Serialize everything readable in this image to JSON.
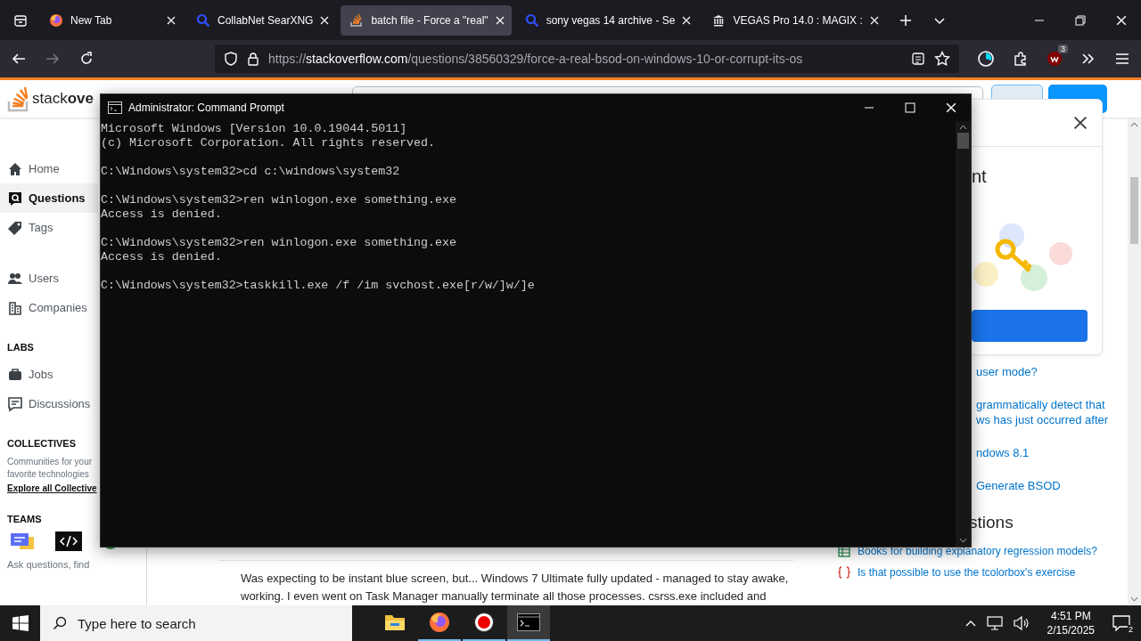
{
  "browser": {
    "tabs": [
      {
        "title": "New Tab",
        "kind": "browser",
        "selected": false
      },
      {
        "title": "CollabNet SearXNG",
        "kind": "search",
        "selected": false
      },
      {
        "title": "batch file - Force a \"real\"",
        "kind": "stack",
        "selected": true
      },
      {
        "title": "sony vegas 14 archive - Se",
        "kind": "search",
        "selected": false
      },
      {
        "title": "VEGAS Pro 14.0 : MAGIX :",
        "kind": "building",
        "selected": false
      }
    ],
    "url": "https://**stackoverflow.com**/questions/38560329/force-a-real-bsod-on-windows-10-or-corrupt-its-os",
    "extension_badge": "3"
  },
  "site": {
    "logo": "stack**ove**",
    "nav": [
      {
        "label": "Home",
        "kind": "home",
        "selected": false
      },
      {
        "label": "Questions",
        "kind": "questions",
        "selected": true
      },
      {
        "label": "Tags",
        "kind": "tags",
        "selected": false
      },
      {
        "label": "Users",
        "kind": "users",
        "selected": false
      },
      {
        "label": "Companies",
        "kind": "companies",
        "selected": false
      }
    ],
    "labs_heading": "LABS",
    "labs": [
      {
        "label": "Jobs",
        "kind": "jobs",
        "selected": false
      },
      {
        "label": "Discussions",
        "kind": "discussions",
        "selected": false
      }
    ],
    "collectives_heading": "COLLECTIVES",
    "collectives_lines": [
      "Communities for your",
      "favorite technologies"
    ],
    "collectives_link": "Explore all Collective",
    "teams_heading": "TEAMS",
    "teams_text": "Ask questions, find",
    "excerpt_lines": [
      "Was expecting to be instant blue screen, but... Windows 7 Ultimate fully updated - managed to stay awake,",
      "working. I even went on Task Manager manually terminate all those processes. csrss.exe included and"
    ],
    "card_heading": "nt",
    "related": [
      {
        "lines": [
          "user mode?"
        ]
      },
      {
        "lines": [
          "grammatically detect that",
          "ws has just occurred after"
        ]
      },
      {
        "lines": [
          "ndows 8.1"
        ]
      },
      {
        "lines": [
          "Generate BSOD"
        ]
      }
    ],
    "hot_heading": "stions",
    "hot": [
      {
        "title": "Books for building explanatory regression models?",
        "kind": "table"
      },
      {
        "title": "Is that possible to use the tcolorbox's exercise",
        "kind": "braces"
      }
    ]
  },
  "cmd": {
    "title": "Administrator: Command Prompt",
    "blocks": [
      [
        "Microsoft Windows [Version 10.0.19044.5011]",
        "(c) Microsoft Corporation. All rights reserved."
      ],
      [
        "C:\\Windows\\system32>cd c:\\windows\\system32"
      ],
      [
        "C:\\Windows\\system32>ren winlogon.exe something.exe",
        "Access is denied."
      ],
      [
        "C:\\Windows\\system32>ren winlogon.exe something.exe",
        "Access is denied."
      ],
      [
        "C:\\Windows\\system32>taskkill.exe /f /im svchost.exe[r/w/]w/]e"
      ]
    ]
  },
  "taskbar": {
    "search_placeholder": "Type here to search",
    "apps": [
      {
        "kind": "folder",
        "running": false,
        "selected": false
      },
      {
        "kind": "browser",
        "running": true,
        "selected": false
      },
      {
        "kind": "record",
        "running": true,
        "selected": false
      },
      {
        "kind": "terminal",
        "running": true,
        "selected": true
      }
    ],
    "time": "4:51 PM",
    "date": "2/15/2025",
    "notifications": "2"
  }
}
